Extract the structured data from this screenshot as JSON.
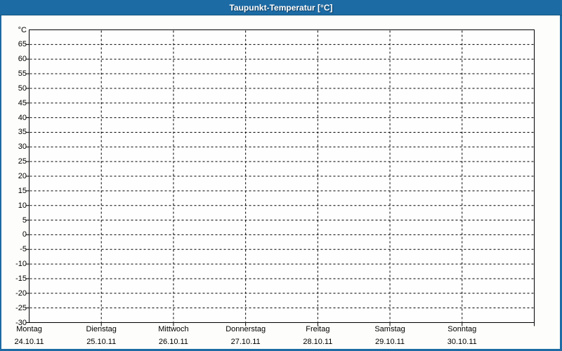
{
  "window": {
    "title": "Taupunkt-Temperatur [°C]"
  },
  "colors": {
    "frame_blue": "#1c6ba5",
    "frame_border_dark": "#14577f",
    "title_text": "#ffffff",
    "content_background": "#fdfdfb",
    "plot_background": "#fefefe",
    "grid_and_axis": "#000000",
    "label_text": "#000000"
  },
  "chart_data": {
    "type": "line",
    "title": "Taupunkt-Temperatur [°C]",
    "ylabel": "°C",
    "y_axis": {
      "min": -30,
      "max": 70,
      "tick_step": 5,
      "ticks": [
        65,
        60,
        55,
        50,
        45,
        40,
        35,
        30,
        25,
        20,
        15,
        10,
        5,
        0,
        -5,
        -10,
        -15,
        -20,
        -25,
        -30
      ]
    },
    "x_axis": {
      "categories": [
        {
          "weekday": "Montag",
          "date": "24.10.11"
        },
        {
          "weekday": "Dienstag",
          "date": "25.10.11"
        },
        {
          "weekday": "Mittwoch",
          "date": "26.10.11"
        },
        {
          "weekday": "Donnerstag",
          "date": "27.10.11"
        },
        {
          "weekday": "Freitag",
          "date": "28.10.11"
        },
        {
          "weekday": "Samstag",
          "date": "29.10.11"
        },
        {
          "weekday": "Sonntag",
          "date": "30.10.11"
        }
      ]
    },
    "series": [],
    "grid": {
      "horizontal": "dashed",
      "vertical": "dashed",
      "shown": true
    },
    "legend": {
      "shown": false
    }
  }
}
